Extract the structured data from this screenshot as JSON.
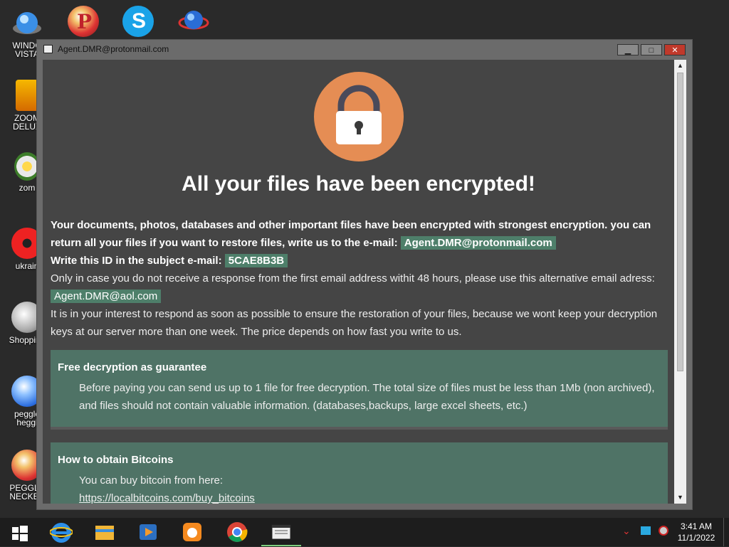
{
  "window": {
    "title": "Agent.DMR@protonmail.com",
    "min": "▁",
    "max": "□",
    "close": "✕"
  },
  "note": {
    "headline": "All your files have been encrypted!",
    "p1": "Your documents, photos, databases and other important files have been encrypted with strongest encryption. you can return all your files if you want to restore files, write us to the e-mail:",
    "email1": "Agent.DMR@protonmail.com",
    "id_label": "Write this ID in the subject e-mail:",
    "id": "5CAE8B3B",
    "p2": "Only in case you do not receive a response from the first email address withit 48 hours, please use this alternative email adress:",
    "email2": "Agent.DMR@aol.com",
    "p3": "It is in your interest to respond as soon as possible to ensure the restoration of your files, because we wont keep your decryption keys at our server more than one week. The price depends on how fast you write to us.",
    "box1_title": "Free decryption as guarantee",
    "box1_text": "Before paying you can send us up to 1 file for free decryption. The total size of files must be less than 1Mb (non archived), and files should not contain valuable information. (databases,backups, large excel sheets, etc.)",
    "box2_title": "How to obtain Bitcoins",
    "box2_text": "You can buy bitcoin from here:",
    "box2_link": "https://localbitcoins.com/buy_bitcoins"
  },
  "desktop_icons": [
    {
      "label1": "WINDO",
      "label2": "VISTA",
      "icon": "windows-vista-icon"
    },
    {
      "label1": "ZOOM",
      "label2": "DELUX",
      "icon": "zoom-game-icon"
    },
    {
      "label1": "zom",
      "label2": "",
      "icon": "zombie-flower-icon"
    },
    {
      "label1": "ukrain",
      "label2": "",
      "icon": "radiation-icon"
    },
    {
      "label1": "Shopping",
      "label2": "",
      "icon": "shopping-icon"
    },
    {
      "label1": "peggle",
      "label2": "heggl",
      "icon": "peggle-icon"
    },
    {
      "label1": "PEGGLE",
      "label2": "NECKBE",
      "icon": "peggle-icon"
    }
  ],
  "top_icons": [
    "peggle-icon",
    "skype-icon",
    "globe-icon"
  ],
  "tray": {
    "time": "3:41 AM",
    "date": "11/1/2022"
  },
  "colors": {
    "lock_circle": "#e58d54",
    "highlight": "#4e7f6a",
    "box": "#4f7366",
    "close_button": "#c0392b"
  }
}
